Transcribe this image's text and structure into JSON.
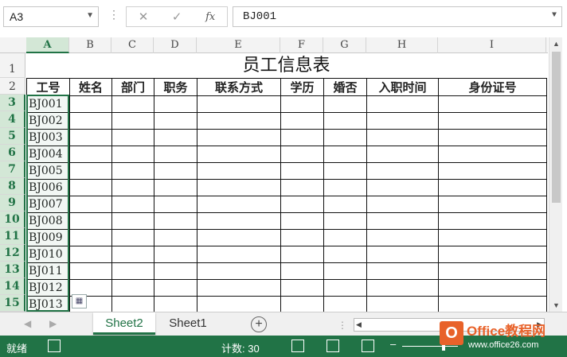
{
  "formula_bar": {
    "name_box": "A3",
    "cancel_icon": "✕",
    "enter_icon": "✓",
    "fx_label": "fx",
    "content": "BJ001"
  },
  "columns": [
    "A",
    "B",
    "C",
    "D",
    "E",
    "F",
    "G",
    "H",
    "I"
  ],
  "rows": [
    "1",
    "2",
    "3",
    "4",
    "5",
    "6",
    "7",
    "8",
    "9",
    "10",
    "11",
    "12",
    "13",
    "14",
    "15"
  ],
  "sheet": {
    "title": "员工信息表",
    "headers": [
      "工号",
      "姓名",
      "部门",
      "职务",
      "联系方式",
      "学历",
      "婚否",
      "入职时间",
      "身份证号"
    ],
    "ids": [
      "BJ001",
      "BJ002",
      "BJ003",
      "BJ004",
      "BJ005",
      "BJ006",
      "BJ007",
      "BJ008",
      "BJ009",
      "BJ010",
      "BJ011",
      "BJ012",
      "BJ013"
    ]
  },
  "tabs": {
    "items": [
      "Sheet2",
      "Sheet1"
    ],
    "active": "Sheet2",
    "add_icon": "+"
  },
  "status": {
    "ready": "就绪",
    "count": "计数: 30"
  },
  "watermark": {
    "brand": "Office教程网",
    "url": "www.office26.com"
  },
  "colors": {
    "accent": "#217346",
    "selection_fill": "#d3e7d6"
  }
}
